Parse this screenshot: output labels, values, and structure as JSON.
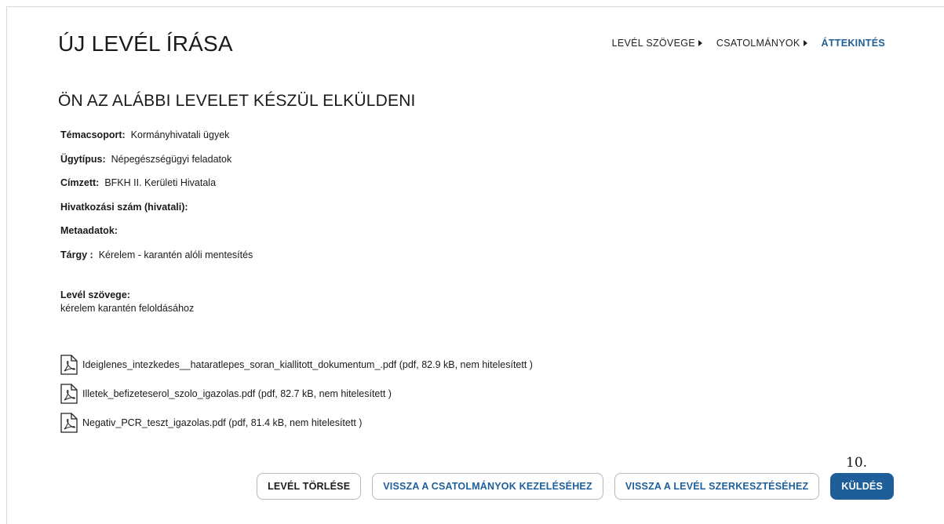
{
  "page_title": "ÚJ LEVÉL ÍRÁSA",
  "steps": [
    {
      "label": "LEVÉL SZÖVEGE",
      "active": false
    },
    {
      "label": "CSATOLMÁNYOK",
      "active": false
    },
    {
      "label": "ÁTTEKINTÉS",
      "active": true
    }
  ],
  "section_title": "ÖN AZ ALÁBBI LEVELET KÉSZÜL ELKÜLDENI",
  "fields": {
    "temacsoport": {
      "label": "Témacsoport:",
      "value": "Kormányhivatali ügyek"
    },
    "ugytipus": {
      "label": "Ügytípus:",
      "value": "Népegészségügyi feladatok"
    },
    "cimzett": {
      "label": "Címzett:",
      "value": "BFKH II. Kerületi Hivatala"
    },
    "hivatkozasi": {
      "label": "Hivatkozási szám (hivatali):",
      "value": ""
    },
    "metaadatok": {
      "label": "Metaadatok:",
      "value": ""
    },
    "targy": {
      "label": "Tárgy :",
      "value": "Kérelem - karantén alóli mentesítés"
    }
  },
  "letter": {
    "label": "Levél szövege:",
    "text": "kérelem karantén feloldásához"
  },
  "attachments": [
    {
      "text": "Ideiglenes_intezkedes__hataratlepes_soran_kiallitott_dokumentum_.pdf (pdf, 82.9 kB, nem hitelesített )",
      "icon": "pdf-file-icon"
    },
    {
      "text": "Illetek_befizeteserol_szolo_igazolas.pdf (pdf, 82.7 kB, nem hitelesített )",
      "icon": "pdf-file-icon"
    },
    {
      "text": "Negativ_PCR_teszt_igazolas.pdf (pdf, 81.4 kB, nem hitelesített )",
      "icon": "pdf-file-icon"
    }
  ],
  "buttons": {
    "delete": "LEVÉL TÖRLÉSE",
    "back_attachments": "VISSZA A CSATOLMÁNYOK KEZELÉSÉHEZ",
    "back_edit": "VISSZA A LEVÉL SZERKESZTÉSÉHEZ",
    "send": "KÜLDÉS"
  },
  "step_marker": "10.",
  "colors": {
    "accent": "#1f5f99",
    "text": "#1a1a1a",
    "border": "#b8b8b8"
  }
}
